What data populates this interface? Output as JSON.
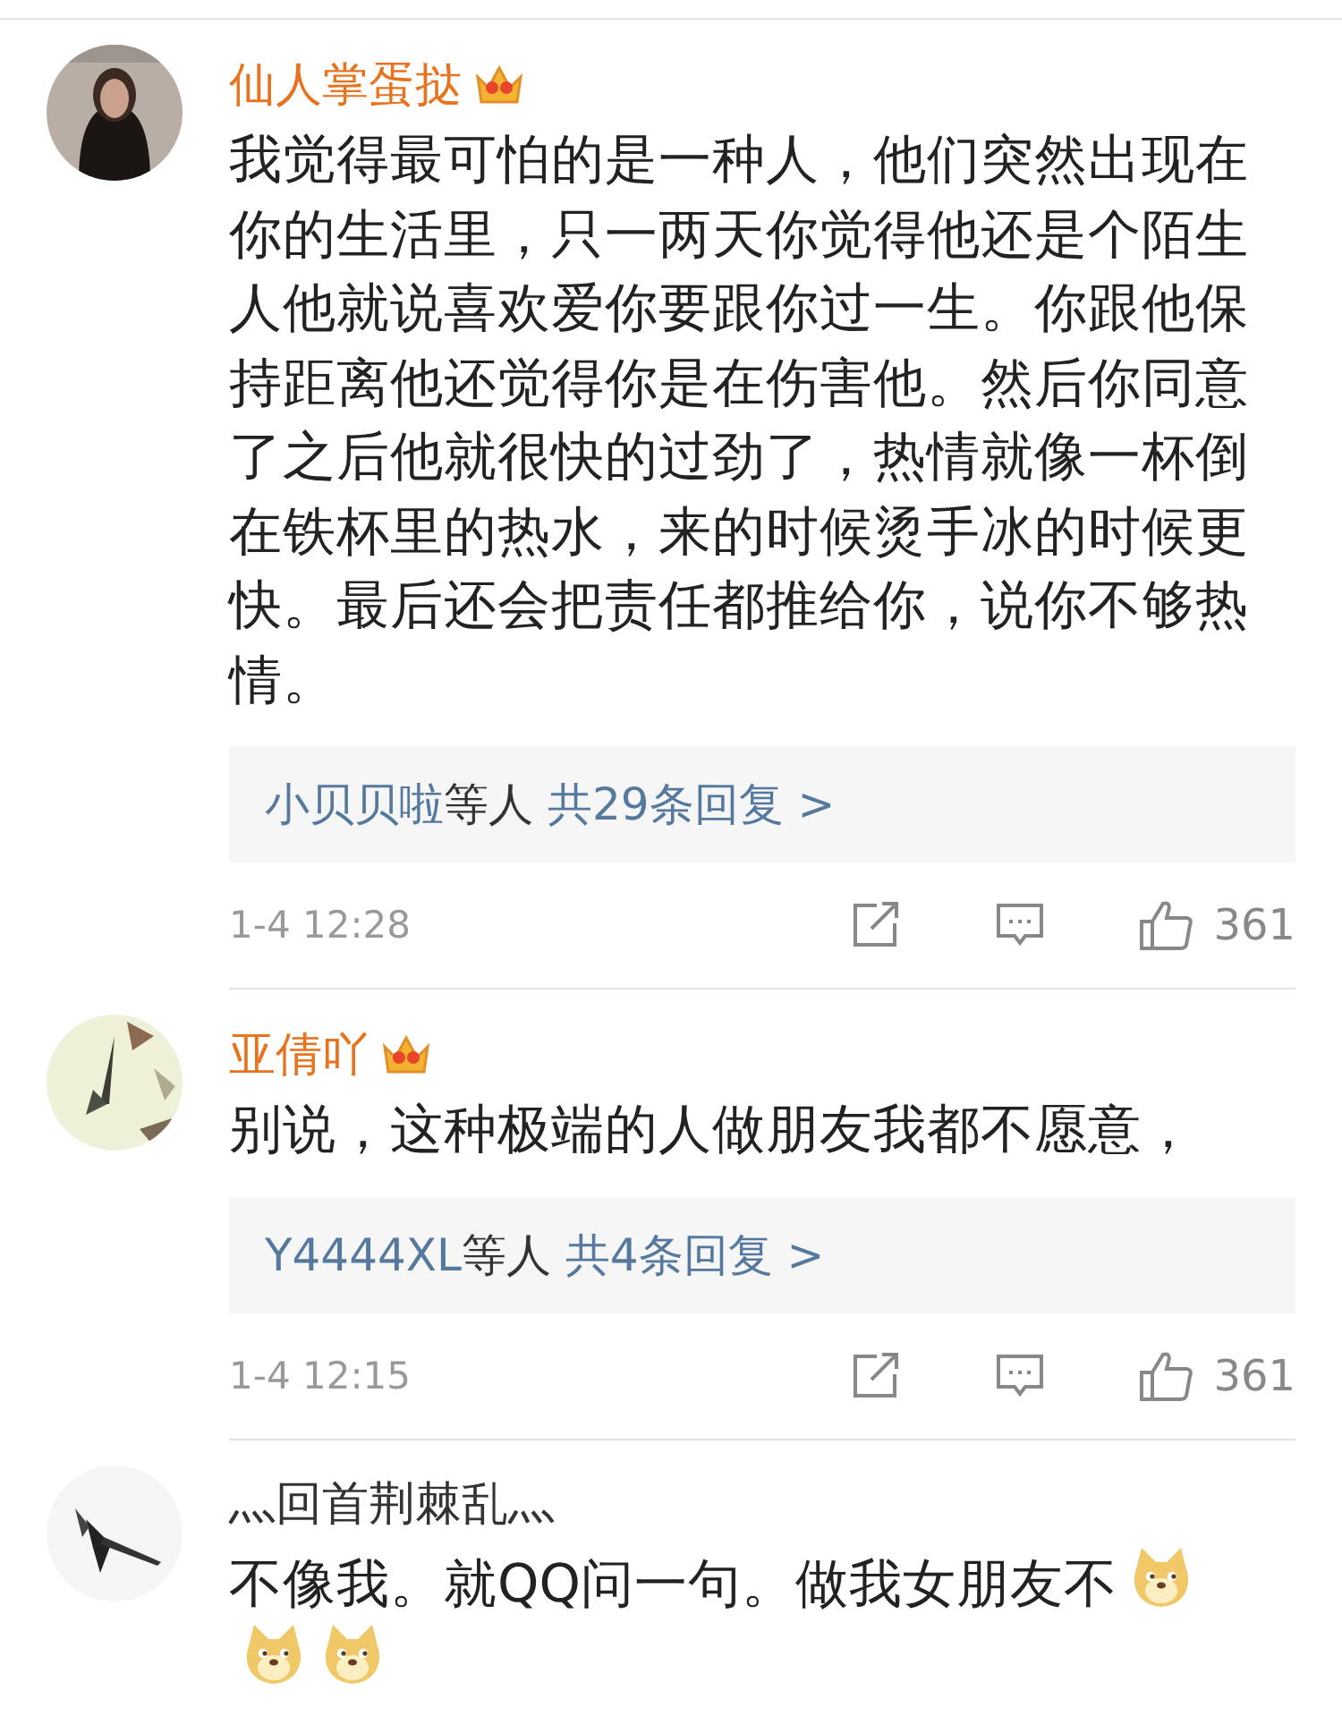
{
  "comments": [
    {
      "author": "仙人掌蛋挞",
      "vip": true,
      "text": "我觉得最可怕的是一种人，他们突然出现在你的生活里，只一两天你觉得他还是个陌生人他就说喜欢爱你要跟你过一生。你跟他保持距离他还觉得你是在伤害他。然后你同意了之后他就很快的过劲了，热情就像一杯倒在铁杯里的热水，来的时候烫手冰的时候更快。最后还会把责任都推给你，说你不够热情。",
      "replies": {
        "names": "小贝贝啦",
        "suffix": "等人",
        "count": "共29条回复 >"
      },
      "time": "1-4 12:28",
      "likes": "361"
    },
    {
      "author": "亚倩吖",
      "vip": true,
      "text": "别说，这种极端的人做朋友我都不愿意，",
      "replies": {
        "names": "Y4444XL",
        "suffix": "等人",
        "count": "共4条回复 >"
      },
      "time": "1-4 12:15",
      "likes": "361"
    },
    {
      "author": "灬回首荆棘乱灬",
      "vip": false,
      "text": "不像我。就QQ问一句。做我女朋友不",
      "emojis": [
        {
          "kind": "dog"
        },
        {
          "kind": "dog"
        },
        {
          "kind": "dog"
        }
      ]
    }
  ]
}
